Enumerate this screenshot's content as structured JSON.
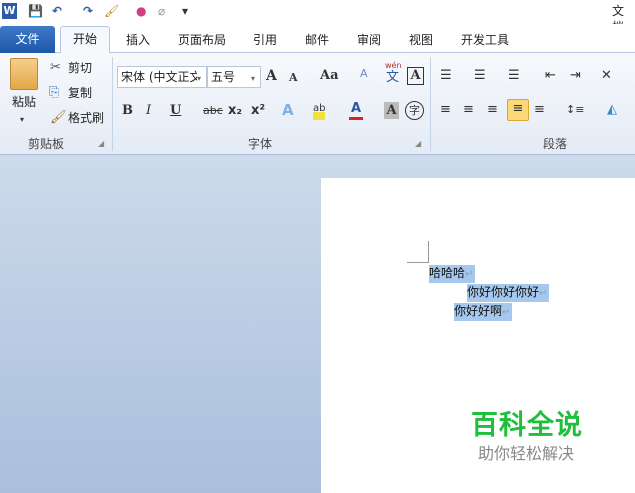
{
  "title": "文档",
  "quick_access": {
    "word": "W",
    "save": "💾",
    "undo": "↶",
    "redo": "↷",
    "brush": "🖌",
    "color": "●",
    "eraser": "⌀",
    "customize": "▾"
  },
  "tabs": [
    "文件",
    "开始",
    "插入",
    "页面布局",
    "引用",
    "邮件",
    "审阅",
    "视图",
    "开发工具"
  ],
  "clipboard": {
    "paste": "粘贴",
    "cut": "剪切",
    "copy": "复制",
    "format_painter": "格式刷",
    "label": "剪贴板"
  },
  "font": {
    "name": "宋体 (中文正文",
    "size": "五号",
    "label": "字体",
    "grow": "A",
    "shrink": "A",
    "case": "Aa",
    "clear": "A",
    "phonetic_top": "wén",
    "phonetic": "文",
    "border": "A",
    "bold": "B",
    "italic": "I",
    "underline": "U",
    "strike": "abc",
    "sub": "x₂",
    "sup": "x²",
    "effect": "A",
    "highlight": "ab",
    "color": "A",
    "shade": "A",
    "enclose": "字"
  },
  "paragraph": {
    "label": "段落",
    "bullets": "☰",
    "numbering": "☰",
    "multilevel": "☰",
    "dec_indent": "⇤",
    "inc_indent": "⇥",
    "sort": "✕",
    "align_left": "≡",
    "center": "≡",
    "align_right": "≡",
    "justify": "≡",
    "distribute": "≡",
    "spacing": "↕≡",
    "fill": "◭"
  },
  "document": {
    "lines": [
      "哈哈哈",
      "你好你好你好",
      "你好好啊"
    ],
    "para_mark": "↵"
  },
  "watermark": {
    "title": "百科全说",
    "subtitle": "助你轻松解决"
  }
}
